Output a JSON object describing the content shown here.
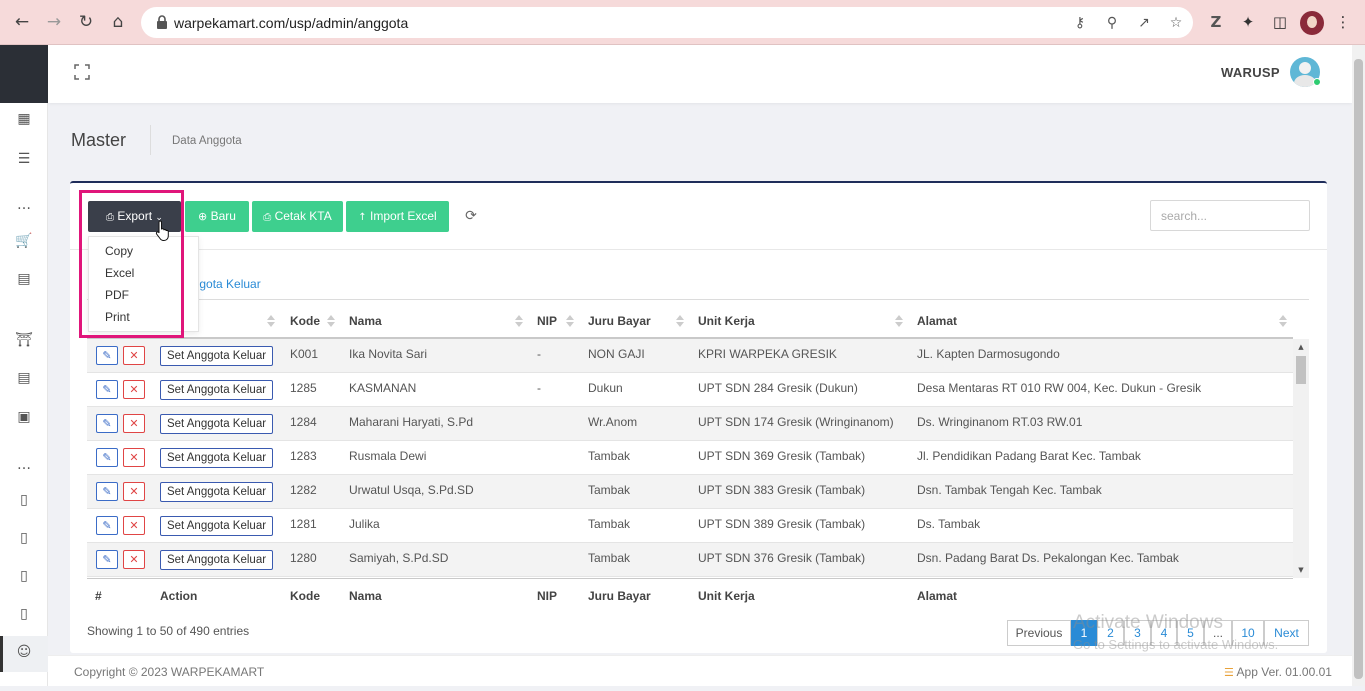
{
  "browser": {
    "url": "warpekamart.com/usp/admin/anggota"
  },
  "header": {
    "username": "WARUSP"
  },
  "breadcrumb": {
    "title": "Master",
    "current": "Data Anggota"
  },
  "toolbar": {
    "export_label": "Export",
    "baru_label": "Baru",
    "cetak_kta_label": "Cetak KTA",
    "import_label": "Import Excel",
    "search_placeholder": "search..."
  },
  "export_menu": [
    "Copy",
    "Excel",
    "PDF",
    "Print"
  ],
  "tab_link": "nggota Keluar",
  "table": {
    "headers": [
      "#",
      "Action",
      "Kode",
      "Nama",
      "NIP",
      "Juru Bayar",
      "Unit Kerja",
      "Alamat"
    ],
    "action_label": "Set Anggota Keluar",
    "rows": [
      {
        "kode": "K001",
        "nama": "Ika Novita Sari",
        "nip": "-",
        "juru_bayar": "NON GAJI",
        "unit_kerja": "KPRI WARPEKA GRESIK",
        "alamat": "JL. Kapten Darmosugondo"
      },
      {
        "kode": "1285",
        "nama": "KASMANAN",
        "nip": "-",
        "juru_bayar": "Dukun",
        "unit_kerja": "UPT SDN 284 Gresik (Dukun)",
        "alamat": "Desa Mentaras RT 010 RW 004, Kec. Dukun - Gresik"
      },
      {
        "kode": "1284",
        "nama": "Maharani Haryati, S.Pd",
        "nip": "",
        "juru_bayar": "Wr.Anom",
        "unit_kerja": "UPT SDN 174 Gresik (Wringinanom)",
        "alamat": "Ds. Wringinanom RT.03 RW.01"
      },
      {
        "kode": "1283",
        "nama": "Rusmala Dewi",
        "nip": "",
        "juru_bayar": "Tambak",
        "unit_kerja": "UPT SDN 369 Gresik (Tambak)",
        "alamat": "Jl. Pendidikan Padang Barat Kec. Tambak"
      },
      {
        "kode": "1282",
        "nama": "Urwatul Usqa, S.Pd.SD",
        "nip": "",
        "juru_bayar": "Tambak",
        "unit_kerja": "UPT SDN 383 Gresik (Tambak)",
        "alamat": "Dsn. Tambak Tengah Kec. Tambak"
      },
      {
        "kode": "1281",
        "nama": "Julika",
        "nip": "",
        "juru_bayar": "Tambak",
        "unit_kerja": "UPT SDN 389 Gresik (Tambak)",
        "alamat": "Ds. Tambak"
      },
      {
        "kode": "1280",
        "nama": "Samiyah, S.Pd.SD",
        "nip": "",
        "juru_bayar": "Tambak",
        "unit_kerja": "UPT SDN 376 Gresik (Tambak)",
        "alamat": "Dsn. Padang Barat Ds. Pekalongan Kec. Tambak"
      }
    ]
  },
  "info": "Showing 1 to 50 of 490 entries",
  "pagination": {
    "previous": "Previous",
    "pages": [
      "1",
      "2",
      "3",
      "4",
      "5",
      "...",
      "10"
    ],
    "next": "Next",
    "active": "1"
  },
  "watermark": {
    "line1": "Activate Windows",
    "line2": "Go to Settings to activate Windows."
  },
  "footer": {
    "copyright": "Copyright © 2023 WARPEKAMART",
    "version": "App Ver. 01.00.01"
  },
  "colors": {
    "accent": "#3ecf8e",
    "dark": "#3a3f4a",
    "highlight": "#e0157a",
    "link": "#2a8bd6"
  }
}
